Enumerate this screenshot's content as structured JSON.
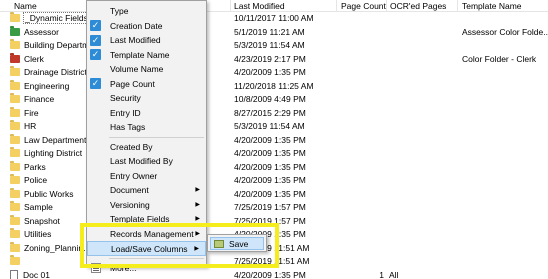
{
  "header": {
    "name": "Name",
    "last_modified": "Last Modified",
    "page_count": "Page Count",
    "ocr_pages": "OCR'ed Pages",
    "template_name": "Template Name"
  },
  "rows": [
    {
      "name": "_Dynamic Fields",
      "modified": "10/11/2017 11:00 AM",
      "page_count": "",
      "ocr": "",
      "template": "",
      "icon": "folder-icon",
      "color": "#f4cf62",
      "selected": true
    },
    {
      "name": "Assessor",
      "modified": "5/1/2019 11:21 AM",
      "page_count": "",
      "ocr": "",
      "template": "Assessor Color Folde...",
      "icon": "folder-icon",
      "color": "#3a9b45"
    },
    {
      "name": "Building Departme...",
      "modified": "5/3/2019 11:54 AM",
      "page_count": "",
      "ocr": "",
      "template": "",
      "icon": "folder-icon",
      "color": "#f4cf62"
    },
    {
      "name": "Clerk",
      "modified": "4/23/2019 2:17 PM",
      "page_count": "",
      "ocr": "",
      "template": "Color Folder - Clerk",
      "icon": "folder-icon",
      "color": "#c0392b"
    },
    {
      "name": "Drainage District",
      "modified": "4/20/2009 1:35 PM",
      "page_count": "",
      "ocr": "",
      "template": "",
      "icon": "folder-icon",
      "color": "#f4cf62"
    },
    {
      "name": "Engineering",
      "modified": "11/20/2018 11:25 AM",
      "page_count": "",
      "ocr": "",
      "template": "",
      "icon": "folder-icon",
      "color": "#f4cf62"
    },
    {
      "name": "Finance",
      "modified": "10/8/2009 4:49 PM",
      "page_count": "",
      "ocr": "",
      "template": "",
      "icon": "folder-icon",
      "color": "#f4cf62"
    },
    {
      "name": "Fire",
      "modified": "8/27/2015 2:29 PM",
      "page_count": "",
      "ocr": "",
      "template": "",
      "icon": "folder-icon",
      "color": "#f4cf62"
    },
    {
      "name": "HR",
      "modified": "5/3/2019 11:54 AM",
      "page_count": "",
      "ocr": "",
      "template": "",
      "icon": "folder-icon",
      "color": "#f4cf62"
    },
    {
      "name": "Law Department",
      "modified": "4/20/2009 1:35 PM",
      "page_count": "",
      "ocr": "",
      "template": "",
      "icon": "folder-icon",
      "color": "#f4cf62"
    },
    {
      "name": "Lighting District",
      "modified": "4/20/2009 1:35 PM",
      "page_count": "",
      "ocr": "",
      "template": "",
      "icon": "folder-icon",
      "color": "#f4cf62"
    },
    {
      "name": "Parks",
      "modified": "4/20/2009 1:35 PM",
      "page_count": "",
      "ocr": "",
      "template": "",
      "icon": "folder-icon",
      "color": "#f4cf62"
    },
    {
      "name": "Police",
      "modified": "4/20/2009 1:35 PM",
      "page_count": "",
      "ocr": "",
      "template": "",
      "icon": "folder-icon",
      "color": "#f4cf62"
    },
    {
      "name": "Public Works",
      "modified": "4/20/2009 1:35 PM",
      "page_count": "",
      "ocr": "",
      "template": "",
      "icon": "folder-icon",
      "color": "#f4cf62"
    },
    {
      "name": "Sample",
      "modified": "7/25/2019 1:57 PM",
      "page_count": "",
      "ocr": "",
      "template": "",
      "icon": "folder-icon",
      "color": "#f4cf62"
    },
    {
      "name": "Snapshot",
      "modified": "7/25/2019 1:57 PM",
      "page_count": "",
      "ocr": "",
      "template": "",
      "icon": "folder-icon",
      "color": "#f4cf62"
    },
    {
      "name": "Utilities",
      "modified": "4/20/2009 1:35 PM",
      "page_count": "",
      "ocr": "",
      "template": "",
      "icon": "folder-icon",
      "color": "#f4cf62"
    },
    {
      "name": "Zoning_Plannin...",
      "modified": "7/25/2019 11:51 AM",
      "page_count": "",
      "ocr": "",
      "template": "",
      "icon": "folder-icon",
      "color": "#f4cf62"
    },
    {
      "name": "",
      "modified": "7/25/2019 11:51 AM",
      "page_count": "",
      "ocr": "",
      "template": "",
      "icon": "folder-icon",
      "color": "#f4cf62"
    },
    {
      "name": "Doc 01",
      "modified": "4/20/2009 1:35 PM",
      "page_count": "1",
      "ocr": "All",
      "template": "",
      "icon": "doc-icon",
      "color": "#ffffff"
    }
  ],
  "menu": {
    "items": [
      {
        "label": "Type",
        "checked": false,
        "submenu": false
      },
      {
        "label": "Creation Date",
        "checked": true,
        "submenu": false
      },
      {
        "label": "Last Modified",
        "checked": true,
        "submenu": false
      },
      {
        "label": "Template Name",
        "checked": true,
        "submenu": false
      },
      {
        "label": "Volume Name",
        "checked": false,
        "submenu": false
      },
      {
        "label": "Page Count",
        "checked": true,
        "submenu": false
      },
      {
        "label": "Security",
        "checked": false,
        "submenu": false
      },
      {
        "label": "Entry ID",
        "checked": false,
        "submenu": false
      },
      {
        "label": "Has Tags",
        "checked": false,
        "submenu": false
      },
      {
        "label": "Created By",
        "checked": false,
        "submenu": false
      },
      {
        "label": "Last Modified By",
        "checked": false,
        "submenu": false
      },
      {
        "label": "Entry Owner",
        "checked": false,
        "submenu": false
      },
      {
        "label": "Document",
        "checked": false,
        "submenu": true
      },
      {
        "label": "Versioning",
        "checked": false,
        "submenu": true
      },
      {
        "label": "Template Fields",
        "checked": false,
        "submenu": true
      },
      {
        "label": "Records Management",
        "checked": false,
        "submenu": true
      },
      {
        "label": "Load/Save Columns",
        "checked": false,
        "submenu": true,
        "active": true
      },
      {
        "label": "More...",
        "checked": false,
        "submenu": false
      }
    ],
    "submenu": {
      "save_label": "Save"
    }
  },
  "colors": {
    "highlight": "#f6ee1c",
    "menu_active": "#cfe6fa",
    "check": "#2e8bd6"
  }
}
